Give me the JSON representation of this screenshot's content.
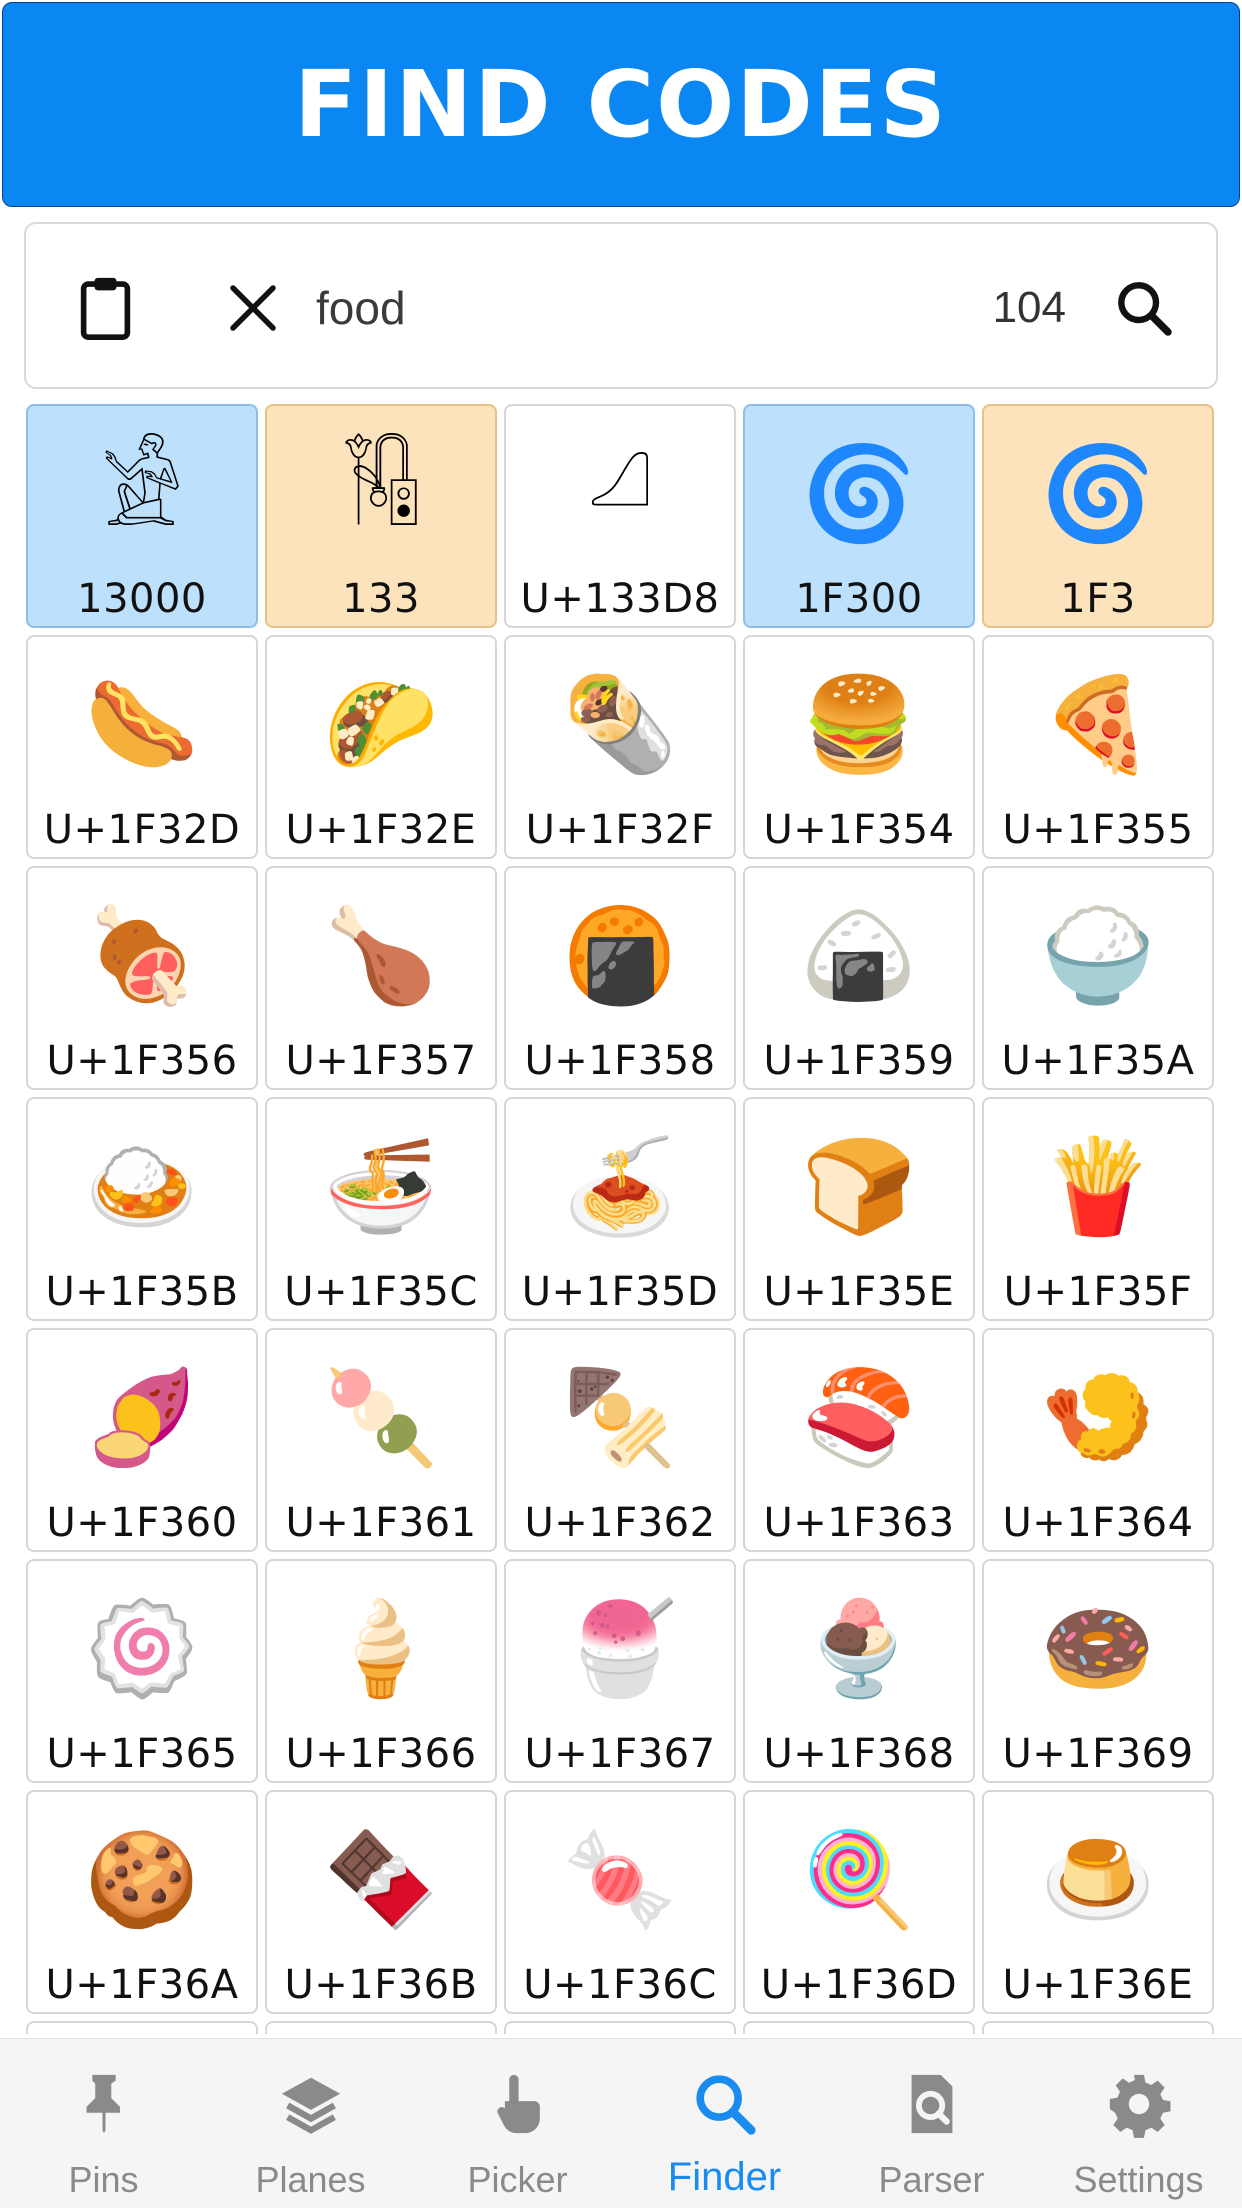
{
  "header": {
    "title": "FIND CODES"
  },
  "search": {
    "value": "food",
    "count": "104"
  },
  "colors": {
    "accent": "#1a8cf0",
    "header_bg": "#0b87f4",
    "highlight_blue": "#bde0fd",
    "highlight_orange": "#fde3bb"
  },
  "results": [
    {
      "code": "13000",
      "glyph": "𓀀",
      "style": "blue",
      "icon": "egyptian-seated-man"
    },
    {
      "code": "133",
      "glyph": "𓏟",
      "style": "orange",
      "icon": "egyptian-reed"
    },
    {
      "code": "U+133D8",
      "glyph": "𓏘",
      "style": "plain",
      "icon": "egyptian-loaf"
    },
    {
      "code": "1F300",
      "glyph": "🌀",
      "style": "blue",
      "icon": "cyclone"
    },
    {
      "code": "1F3",
      "glyph": "🌀",
      "style": "orange",
      "icon": "cyclone"
    },
    {
      "code": "U+1F32D",
      "glyph": "🌭",
      "style": "plain",
      "icon": "hot-dog"
    },
    {
      "code": "U+1F32E",
      "glyph": "🌮",
      "style": "plain",
      "icon": "taco"
    },
    {
      "code": "U+1F32F",
      "glyph": "🌯",
      "style": "plain",
      "icon": "burrito"
    },
    {
      "code": "U+1F354",
      "glyph": "🍔",
      "style": "plain",
      "icon": "hamburger"
    },
    {
      "code": "U+1F355",
      "glyph": "🍕",
      "style": "plain",
      "icon": "pizza"
    },
    {
      "code": "U+1F356",
      "glyph": "🍖",
      "style": "plain",
      "icon": "meat-on-bone"
    },
    {
      "code": "U+1F357",
      "glyph": "🍗",
      "style": "plain",
      "icon": "poultry-leg"
    },
    {
      "code": "U+1F358",
      "glyph": "🍘",
      "style": "plain",
      "icon": "rice-cracker"
    },
    {
      "code": "U+1F359",
      "glyph": "🍙",
      "style": "plain",
      "icon": "rice-ball"
    },
    {
      "code": "U+1F35A",
      "glyph": "🍚",
      "style": "plain",
      "icon": "cooked-rice"
    },
    {
      "code": "U+1F35B",
      "glyph": "🍛",
      "style": "plain",
      "icon": "curry-rice"
    },
    {
      "code": "U+1F35C",
      "glyph": "🍜",
      "style": "plain",
      "icon": "steaming-bowl"
    },
    {
      "code": "U+1F35D",
      "glyph": "🍝",
      "style": "plain",
      "icon": "spaghetti"
    },
    {
      "code": "U+1F35E",
      "glyph": "🍞",
      "style": "plain",
      "icon": "bread"
    },
    {
      "code": "U+1F35F",
      "glyph": "🍟",
      "style": "plain",
      "icon": "french-fries"
    },
    {
      "code": "U+1F360",
      "glyph": "🍠",
      "style": "plain",
      "icon": "roasted-sweet-potato"
    },
    {
      "code": "U+1F361",
      "glyph": "🍡",
      "style": "plain",
      "icon": "dango"
    },
    {
      "code": "U+1F362",
      "glyph": "🍢",
      "style": "plain",
      "icon": "oden"
    },
    {
      "code": "U+1F363",
      "glyph": "🍣",
      "style": "plain",
      "icon": "sushi"
    },
    {
      "code": "U+1F364",
      "glyph": "🍤",
      "style": "plain",
      "icon": "fried-shrimp"
    },
    {
      "code": "U+1F365",
      "glyph": "🍥",
      "style": "plain",
      "icon": "fish-cake"
    },
    {
      "code": "U+1F366",
      "glyph": "🍦",
      "style": "plain",
      "icon": "soft-ice-cream"
    },
    {
      "code": "U+1F367",
      "glyph": "🍧",
      "style": "plain",
      "icon": "shaved-ice"
    },
    {
      "code": "U+1F368",
      "glyph": "🍨",
      "style": "plain",
      "icon": "ice-cream"
    },
    {
      "code": "U+1F369",
      "glyph": "🍩",
      "style": "plain",
      "icon": "doughnut"
    },
    {
      "code": "U+1F36A",
      "glyph": "🍪",
      "style": "plain",
      "icon": "cookie"
    },
    {
      "code": "U+1F36B",
      "glyph": "🍫",
      "style": "plain",
      "icon": "chocolate-bar"
    },
    {
      "code": "U+1F36C",
      "glyph": "🍬",
      "style": "plain",
      "icon": "candy"
    },
    {
      "code": "U+1F36D",
      "glyph": "🍭",
      "style": "plain",
      "icon": "lollipop"
    },
    {
      "code": "U+1F36E",
      "glyph": "🍮",
      "style": "plain",
      "icon": "custard"
    },
    {
      "code": "",
      "glyph": "",
      "style": "plain",
      "icon": ""
    },
    {
      "code": "",
      "glyph": "",
      "style": "plain",
      "icon": ""
    },
    {
      "code": "",
      "glyph": "",
      "style": "plain",
      "icon": ""
    },
    {
      "code": "",
      "glyph": "",
      "style": "plain",
      "icon": ""
    },
    {
      "code": "",
      "glyph": "",
      "style": "plain",
      "icon": ""
    }
  ],
  "tabs": [
    {
      "label": "Pins",
      "icon": "pin-icon",
      "active": false
    },
    {
      "label": "Planes",
      "icon": "layers-icon",
      "active": false
    },
    {
      "label": "Picker",
      "icon": "hand-pointer-icon",
      "active": false
    },
    {
      "label": "Finder",
      "icon": "search-icon",
      "active": true
    },
    {
      "label": "Parser",
      "icon": "document-search-icon",
      "active": false
    },
    {
      "label": "Settings",
      "icon": "gear-icon",
      "active": false
    }
  ]
}
